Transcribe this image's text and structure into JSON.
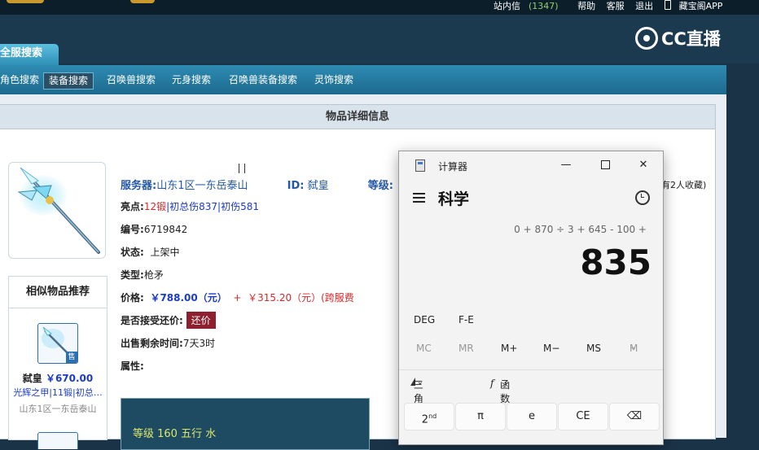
{
  "topbar": {
    "inbox_label": "站内信",
    "inbox_count": "(1347)",
    "help": "帮助",
    "service": "客服",
    "logout": "退出",
    "app": "藏宝阁APP"
  },
  "cc_logo": "CC直播",
  "tab_active": "全服搜索",
  "nav": [
    "角色搜索",
    "装备搜索",
    "召唤兽搜索",
    "元身搜索",
    "召唤兽装备搜索",
    "灵饰搜索"
  ],
  "nav_selected": 1,
  "panel_title": "物品详细信息",
  "item": {
    "server_label": "服务器:",
    "server_value": "山东1区一东岳泰山",
    "id_label": "ID:",
    "id_value": "弑皇",
    "level_label": "等级:",
    "favorites_peek": "有2人收藏)",
    "highlight_label": "亮点:",
    "highlight_forge": "12锻",
    "highlight_rest": "|初总伤837|初伤581",
    "number_label": "编号:",
    "number_value": "6719842",
    "status_label": "状态:",
    "status_value": "上架中",
    "type_label": "类型:",
    "type_value": "枪矛",
    "price_label": "价格:",
    "price_value": "￥788.00（元）",
    "price_plus": "+",
    "price_extra": "￥315.20（元）(跨服费",
    "offer_label": "是否接受还价:",
    "offer_button": "还价",
    "time_label": "出售剩余时间:",
    "time_value": "7天3时",
    "attr_label": "属性:",
    "attr_box": "等级 160 五行 水"
  },
  "similar": {
    "title": "相似物品推荐",
    "badge": "售",
    "name": "弑皇",
    "price": "￥670.00",
    "desc": "光辉之甲|11锻|初总…",
    "server": "山东1区一东岳泰山"
  },
  "calculator": {
    "title": "计算器",
    "mode": "科学",
    "expression": "0 + 870 ÷ 3 + 645 - 100 +",
    "result": "835",
    "deg": "DEG",
    "fe": "F-E",
    "memory": [
      "MC",
      "MR",
      "M+",
      "M−",
      "MS",
      "M"
    ],
    "trig": "三角学",
    "func": "函数",
    "keys": [
      "2",
      "π",
      "e",
      "CE",
      "⌫"
    ],
    "key_2_sup": "nd"
  }
}
